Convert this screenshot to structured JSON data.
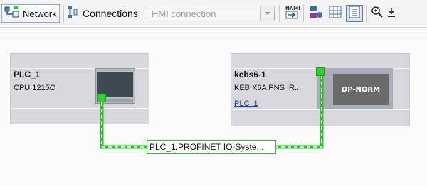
{
  "toolbar": {
    "network_label": "Network",
    "connections_label": "Connections",
    "connection_type": "HMI connection",
    "icons": [
      "network-view-icon",
      "connections-icon",
      "dropdown-arrow-icon",
      "name-rename-icon",
      "device-overview-icon",
      "table-view-icon",
      "list-view-icon",
      "zoom-in-icon",
      "download-icon"
    ]
  },
  "devices": [
    {
      "name": "PLC_1",
      "type": "CPU 1215C"
    },
    {
      "name": "kebs6-1",
      "type": "KEB X6A PNS IR...",
      "link": "PLC_1",
      "module": "DP-NORM"
    }
  ],
  "network": {
    "io_system": "PLC_1.PROFINET IO-Syste..."
  },
  "colors": {
    "profinet_line": "#2fbf2f",
    "port": "#2fd02f",
    "link": "#1b3fbd"
  }
}
